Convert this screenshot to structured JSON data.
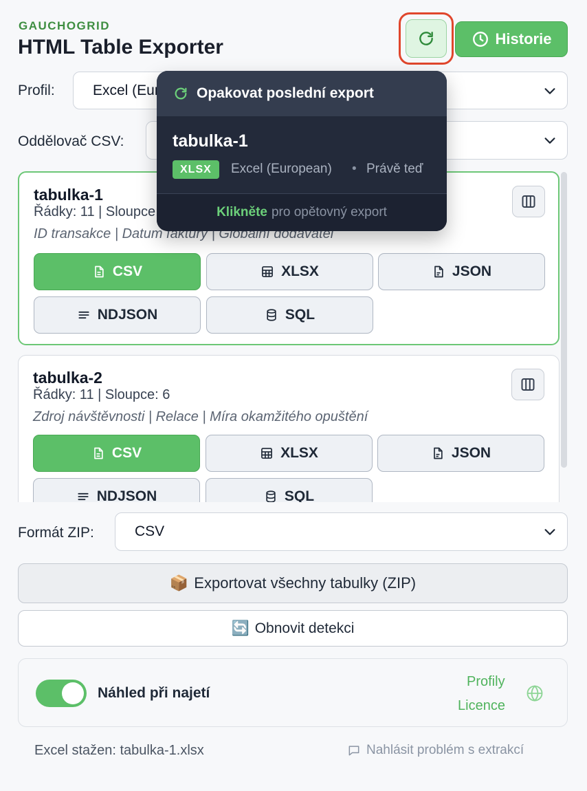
{
  "header": {
    "brand": "GAUCHOGRID",
    "title": "HTML Table Exporter",
    "history_label": "Historie"
  },
  "profile": {
    "label": "Profil:",
    "value": "Excel (European)"
  },
  "csv_separator": {
    "label": "Oddělovač CSV:",
    "value": ""
  },
  "tables": [
    {
      "name": "tabulka-1",
      "meta": "Řádky: 11 | Sloupce: 6",
      "columns": "ID transakce | Datum faktury | Globální dodavatel",
      "formats": [
        "CSV",
        "XLSX",
        "JSON",
        "NDJSON",
        "SQL"
      ]
    },
    {
      "name": "tabulka-2",
      "meta": "Řádky: 11 | Sloupce: 6",
      "columns": "Zdroj návštěvnosti | Relace | Míra okamžitého opuštění",
      "formats": [
        "CSV",
        "XLSX",
        "JSON",
        "NDJSON",
        "SQL"
      ]
    }
  ],
  "zip": {
    "label": "Formát ZIP:",
    "value": "CSV",
    "export_all_icon": "📦",
    "export_all_label": "Exportovat všechny tabulky (ZIP)",
    "refresh_icon": "🔄",
    "refresh_label": "Obnovit detekci"
  },
  "settings": {
    "hover_preview_label": "Náhled při najetí",
    "hover_preview_on": true,
    "profiles_link": "Profily",
    "license_link": "Licence"
  },
  "footer": {
    "status": "Excel stažen: tabulka-1.xlsx",
    "report": "Nahlásit problém s extrakcí"
  },
  "tooltip": {
    "title": "Opakovat poslední export",
    "table_name": "tabulka-1",
    "format_badge": "XLSX",
    "profile": "Excel (European)",
    "separator": "•",
    "time": "Právě teď",
    "hint_bold": "Klikněte",
    "hint_rest": "pro opětovný export"
  },
  "colors": {
    "accent_green": "#5cbf68",
    "highlight_red": "#e0462c",
    "tooltip_bg": "#232a3a"
  }
}
